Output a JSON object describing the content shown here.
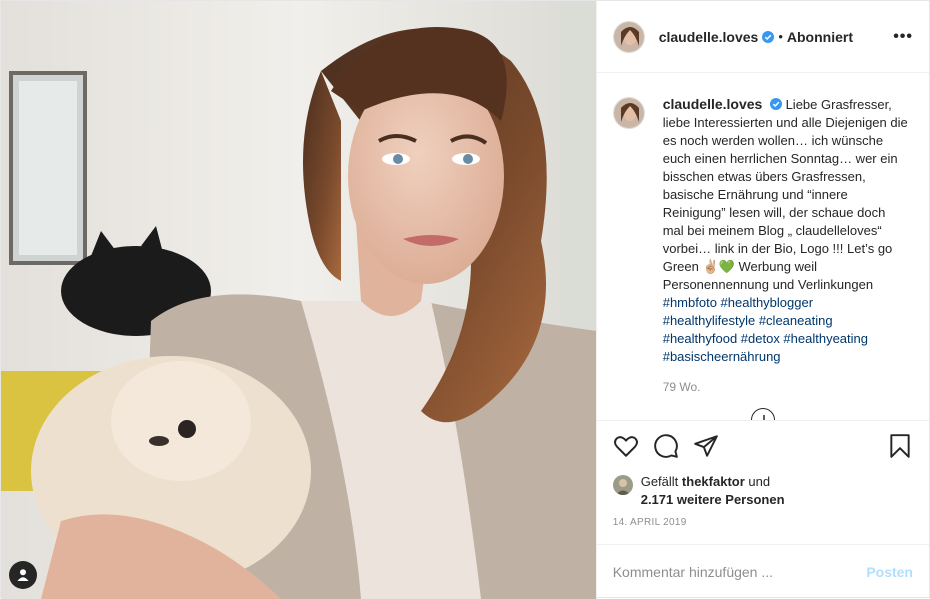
{
  "post": {
    "username": "claudelle.loves",
    "follow_separator": "•",
    "follow_state": "Abonniert",
    "more_label": "•••",
    "caption": {
      "username": "claudelle.loves",
      "text": "Liebe Grasfresser, liebe Interessierten und alle Diejenigen die es noch werden wollen… ich wünsche euch einen herrlichen Sonntag… wer ein bisschen etwas übers Grasfressen, basische Ernährung und “innere Reinigung” lesen will, der schaue doch mal bei meinem Blog „ claudelleloves“ vorbei… link in der Bio, Logo !!! Let’s go Green ✌🏼💚 Werbung weil Personennennung und Verlinkungen ",
      "hashtags": "#hmbfoto #healthyblogger #healthylifestyle #cleaneating #healthyfood #detox #healthyeating #basischeernährung"
    },
    "time_ago": "79 Wo.",
    "likes": {
      "prefix": "Gefällt",
      "user": "thekfaktor",
      "connector": "und",
      "count_text": "2.171 weitere Personen"
    },
    "date": "14. APRIL 2019",
    "comment_placeholder": "Kommentar hinzufügen ...",
    "post_button": "Posten"
  },
  "icons": {
    "verified": "verified-badge-icon",
    "like": "heart-icon",
    "comment": "speech-bubble-icon",
    "share": "paper-plane-icon",
    "save": "bookmark-icon",
    "user_tag": "person-icon",
    "load_more": "plus-circle-icon"
  },
  "colors": {
    "verified": "#3897f0",
    "link": "#00376b",
    "muted": "#8e8e8e",
    "post_button_disabled": "#b2dffc"
  }
}
